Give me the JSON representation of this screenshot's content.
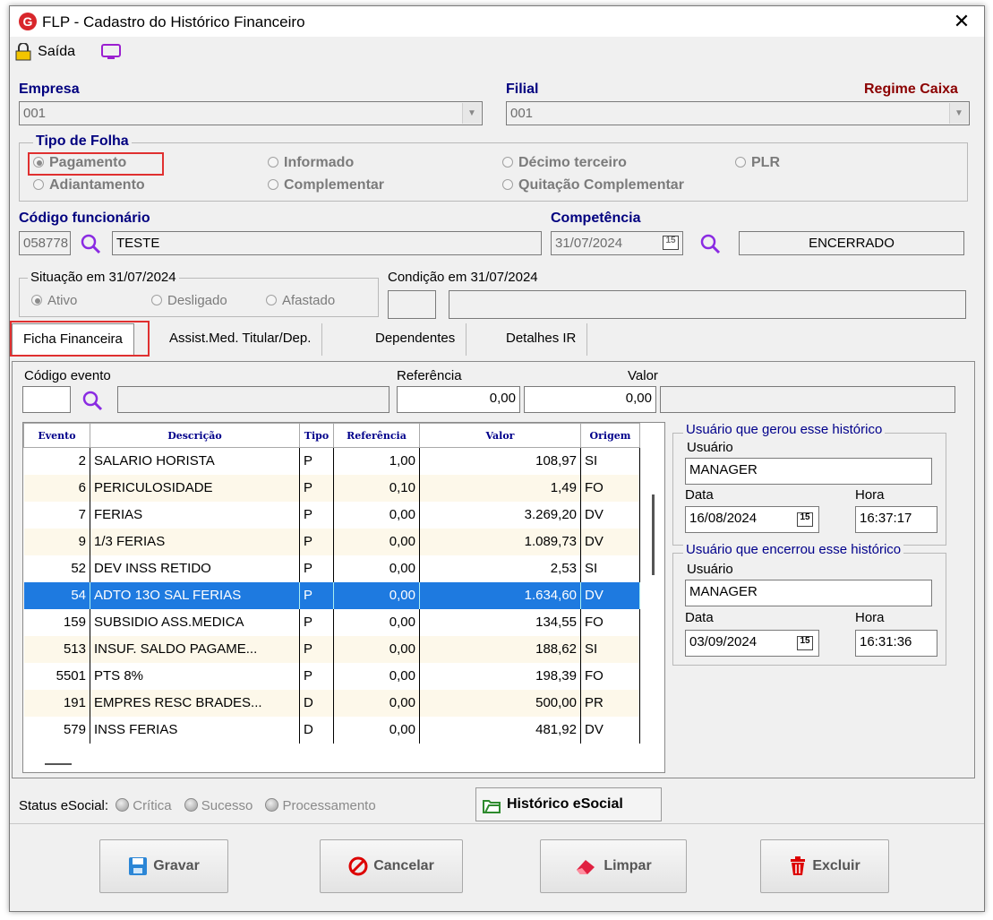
{
  "window": {
    "title": "FLP - Cadastro do Histórico Financeiro",
    "logo_letter": "G",
    "close": "✕"
  },
  "toolbar": {
    "exit_label": "Saída"
  },
  "empresa": {
    "label": "Empresa",
    "value": "001"
  },
  "filial": {
    "label": "Filial",
    "value": "001"
  },
  "regime": {
    "label": "Regime Caixa"
  },
  "tipo_folha": {
    "title": "Tipo de Folha",
    "options": [
      "Pagamento",
      "Informado",
      "Décimo terceiro",
      "PLR",
      "Adiantamento",
      "Complementar",
      "Quitação Complementar"
    ],
    "selected": "Pagamento"
  },
  "funcionario": {
    "label": "Código funcionário",
    "code": "058778",
    "name": "TESTE"
  },
  "competencia": {
    "label": "Competência",
    "date": "31/07/2024",
    "cal": "15",
    "status": "ENCERRADO"
  },
  "situacao": {
    "title": "Situação em  31/07/2024",
    "options": [
      "Ativo",
      "Desligado",
      "Afastado"
    ],
    "selected": "Ativo"
  },
  "condicao": {
    "title": "Condição em 31/07/2024",
    "code": "",
    "desc": ""
  },
  "tabs": [
    "Ficha Financeira",
    "Assist.Med. Titular/Dep.",
    "Dependentes",
    "Detalhes IR"
  ],
  "evento_form": {
    "codigo_label": "Código evento",
    "referencia_label": "Referência",
    "valor_label": "Valor",
    "referencia": "0,00",
    "valor": "0,00"
  },
  "grid": {
    "headers": [
      "Evento",
      "Descrição",
      "Tipo",
      "Referência",
      "Valor",
      "Origem"
    ],
    "rows": [
      [
        "2",
        "SALARIO HORISTA",
        "P",
        "1,00",
        "108,97",
        "SI"
      ],
      [
        "6",
        "PERICULOSIDADE",
        "P",
        "0,10",
        "1,49",
        "FO"
      ],
      [
        "7",
        "FERIAS",
        "P",
        "0,00",
        "3.269,20",
        "DV"
      ],
      [
        "9",
        "1/3 FERIAS",
        "P",
        "0,00",
        "1.089,73",
        "DV"
      ],
      [
        "52",
        "DEV INSS RETIDO",
        "P",
        "0,00",
        "2,53",
        "SI"
      ],
      [
        "54",
        "ADTO 13O SAL FERIAS",
        "P",
        "0,00",
        "1.634,60",
        "DV"
      ],
      [
        "159",
        "SUBSIDIO ASS.MEDICA",
        "P",
        "0,00",
        "134,55",
        "FO"
      ],
      [
        "513",
        "INSUF. SALDO PAGAME...",
        "P",
        "0,00",
        "188,62",
        "SI"
      ],
      [
        "5501",
        "PTS 8%",
        "P",
        "0,00",
        "198,39",
        "FO"
      ],
      [
        "191",
        "EMPRES RESC BRADES...",
        "D",
        "0,00",
        "500,00",
        "PR"
      ],
      [
        "579",
        "INSS FERIAS",
        "D",
        "0,00",
        "481,92",
        "DV"
      ]
    ],
    "selected_row": 5
  },
  "gerou": {
    "title": "Usuário que gerou esse histórico",
    "usuario_label": "Usuário",
    "usuario": "MANAGER",
    "data_label": "Data",
    "data": "16/08/2024",
    "hora_label": "Hora",
    "hora": "16:37:17"
  },
  "encerrou": {
    "title": "Usuário que encerrou esse histórico",
    "usuario_label": "Usuário",
    "usuario": "MANAGER",
    "data_label": "Data",
    "data": "03/09/2024",
    "hora_label": "Hora",
    "hora": "16:31:36"
  },
  "esocial": {
    "label": "Status eSocial:",
    "critica": "Crítica",
    "sucesso": "Sucesso",
    "processamento": "Processamento",
    "historico_btn": "Histórico eSocial"
  },
  "buttons": {
    "gravar": "Gravar",
    "cancelar": "Cancelar",
    "limpar": "Limpar",
    "excluir": "Excluir"
  },
  "colors": {
    "accent_blue": "#00007f",
    "selection": "#1e7ae0",
    "highlight_red": "#e03030"
  }
}
